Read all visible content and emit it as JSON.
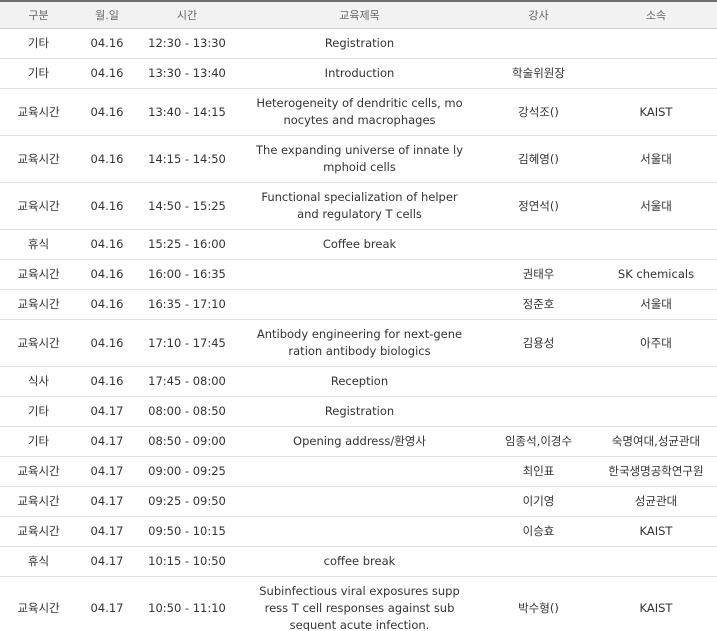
{
  "headers": [
    "구분",
    "월.일",
    "시간",
    "교육제목",
    "강사",
    "소속"
  ],
  "rows": [
    {
      "category": "기타",
      "date": "04.16",
      "time": "12:30 - 13:30",
      "title": "Registration",
      "lecturer": "",
      "affiliation": ""
    },
    {
      "category": "기타",
      "date": "04.16",
      "time": "13:30 - 13:40",
      "title": "Introduction",
      "lecturer": "학술위원장",
      "affiliation": ""
    },
    {
      "category": "교육시간",
      "date": "04.16",
      "time": "13:40 - 14:15",
      "title": "Heterogeneity of dendritic cells, mo\nnocytes and macrophages",
      "lecturer": "강석조()",
      "affiliation": "KAIST"
    },
    {
      "category": "교육시간",
      "date": "04.16",
      "time": "14:15 - 14:50",
      "title": "The expanding universe of innate ly\nmphoid cells",
      "lecturer": "김혜영()",
      "affiliation": "서울대"
    },
    {
      "category": "교육시간",
      "date": "04.16",
      "time": "14:50 - 15:25",
      "title": "Functional specialization of helper\nand regulatory T cells",
      "lecturer": "정연석()",
      "affiliation": "서울대"
    },
    {
      "category": "휴식",
      "date": "04.16",
      "time": "15:25 - 16:00",
      "title": "Coffee break",
      "lecturer": "",
      "affiliation": ""
    },
    {
      "category": "교육시간",
      "date": "04.16",
      "time": "16:00 - 16:35",
      "title": "",
      "lecturer": "권태우",
      "affiliation": "SK chemicals"
    },
    {
      "category": "교육시간",
      "date": "04.16",
      "time": "16:35 - 17:10",
      "title": "",
      "lecturer": "정준호",
      "affiliation": "서울대"
    },
    {
      "category": "교육시간",
      "date": "04.16",
      "time": "17:10 - 17:45",
      "title": "Antibody engineering for next-gene\nration antibody biologics",
      "lecturer": "김용성",
      "affiliation": "아주대"
    },
    {
      "category": "식사",
      "date": "04.16",
      "time": "17:45 - 08:00",
      "title": "Reception",
      "lecturer": "",
      "affiliation": ""
    },
    {
      "category": "기타",
      "date": "04.17",
      "time": "08:00 - 08:50",
      "title": "Registration",
      "lecturer": "",
      "affiliation": ""
    },
    {
      "category": "기타",
      "date": "04.17",
      "time": "08:50 - 09:00",
      "title": "Opening address/환영사",
      "lecturer": "임종석,이경수",
      "affiliation": "숙명여대,성균관대"
    },
    {
      "category": "교육시간",
      "date": "04.17",
      "time": "09:00 - 09:25",
      "title": "",
      "lecturer": "최인표",
      "affiliation": "한국생명공학연구원"
    },
    {
      "category": "교육시간",
      "date": "04.17",
      "time": "09:25 - 09:50",
      "title": "",
      "lecturer": "이기영",
      "affiliation": "성균관대"
    },
    {
      "category": "교육시간",
      "date": "04.17",
      "time": "09:50 - 10:15",
      "title": "",
      "lecturer": "이승효",
      "affiliation": "KAIST"
    },
    {
      "category": "휴식",
      "date": "04.17",
      "time": "10:15 - 10:50",
      "title": "coffee break",
      "lecturer": "",
      "affiliation": ""
    },
    {
      "category": "교육시간",
      "date": "04.17",
      "time": "10:50 - 11:10",
      "title": "Subinfectious viral exposures supp\nress T cell responses against sub\nsequent acute infection.",
      "lecturer": "박수형()",
      "affiliation": "KAIST"
    }
  ]
}
